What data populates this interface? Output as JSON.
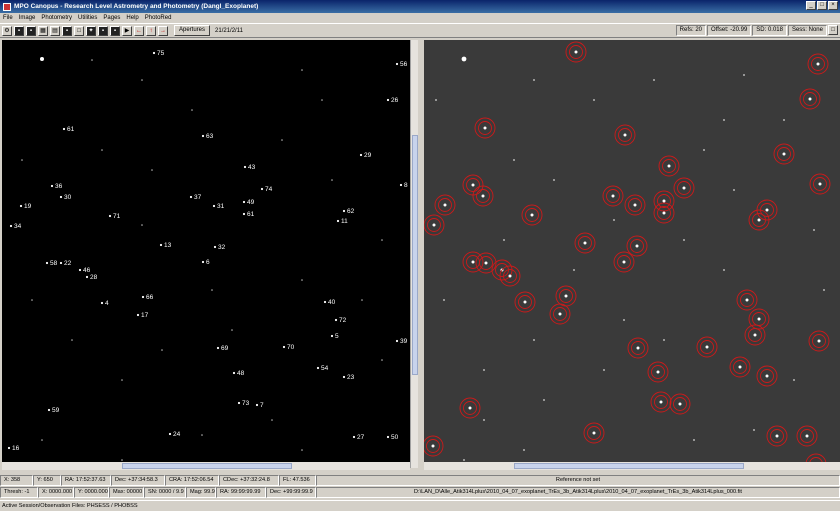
{
  "window": {
    "title": "MPO Canopus - Research Level Astrometry and Photometry (Dangl_Exoplanet)",
    "controls": [
      "_",
      "□",
      "×"
    ]
  },
  "menu": [
    "File",
    "Image",
    "Photometry",
    "Utilities",
    "Pages",
    "Help",
    "PhotoRed"
  ],
  "toolbar": {
    "apertures_label": "Apertures",
    "date": "21/21/2/11"
  },
  "toolbar_status": {
    "refs": "Refs: 20",
    "offset": "Offset: -20.99",
    "sd": "SD: 0.018",
    "sess": "Sess: None"
  },
  "chart_labels": [
    {
      "id": "75"
    },
    {
      "id": "56"
    },
    {
      "id": "26"
    },
    {
      "id": "61"
    },
    {
      "id": "63"
    },
    {
      "id": "29"
    },
    {
      "id": "43"
    },
    {
      "id": "8"
    },
    {
      "id": "36"
    },
    {
      "id": "74"
    },
    {
      "id": "30"
    },
    {
      "id": "37"
    },
    {
      "id": "49"
    },
    {
      "id": "19"
    },
    {
      "id": "31"
    },
    {
      "id": "62"
    },
    {
      "id": "71"
    },
    {
      "id": "61"
    },
    {
      "id": "11"
    },
    {
      "id": "34"
    },
    {
      "id": "13"
    },
    {
      "id": "32"
    },
    {
      "id": "58"
    },
    {
      "id": "22"
    },
    {
      "id": "6"
    },
    {
      "id": "46"
    },
    {
      "id": "28"
    },
    {
      "id": "66"
    },
    {
      "id": "4"
    },
    {
      "id": "40"
    },
    {
      "id": "17"
    },
    {
      "id": "72"
    },
    {
      "id": "5"
    },
    {
      "id": "39"
    },
    {
      "id": "69"
    },
    {
      "id": "70"
    },
    {
      "id": "54"
    },
    {
      "id": "48"
    },
    {
      "id": "23"
    },
    {
      "id": "73"
    },
    {
      "id": "7"
    },
    {
      "id": "59"
    },
    {
      "id": "24"
    },
    {
      "id": "27"
    },
    {
      "id": "50"
    },
    {
      "id": "16"
    }
  ],
  "status1": {
    "x": "X: 358",
    "y": "Y: 650",
    "ra": "RA: 17:52:37.63",
    "dec": "Dec: +37:34:58.3",
    "cra": "CRA: 17:52:06.54",
    "cdec": "CDec: +37:32:24.8",
    "fl": "FL: 47.536",
    "ref": "Reference not set"
  },
  "status2": {
    "thresh": "Thresh: -1",
    "x": "X: 0000.000",
    "y": "Y: 0000.000",
    "max": "Max: 00000",
    "sn": "SN: 0000 / 9.9",
    "mag": "Mag: 99.99",
    "ra": "RA: 99:99:99.99",
    "dec": "Dec: +99:99:99.9",
    "file": "D:\\LAN_D\\Alle_Atik314Lplus\\2010_04_07_exoplanet_TrEs_3b_Atik314Lplus\\2010_04_07_exoplanet_TrEs_3b_Atik314Lplus_000.fit"
  },
  "bottom_text": "Active Session/Observation Files: PHSESS / PHOBSS",
  "colors": {
    "titlebar": "#0a246a",
    "aperture_ring": "#cc1a1a",
    "chart_bg": "#000000",
    "image_bg": "#3a3a3a"
  }
}
